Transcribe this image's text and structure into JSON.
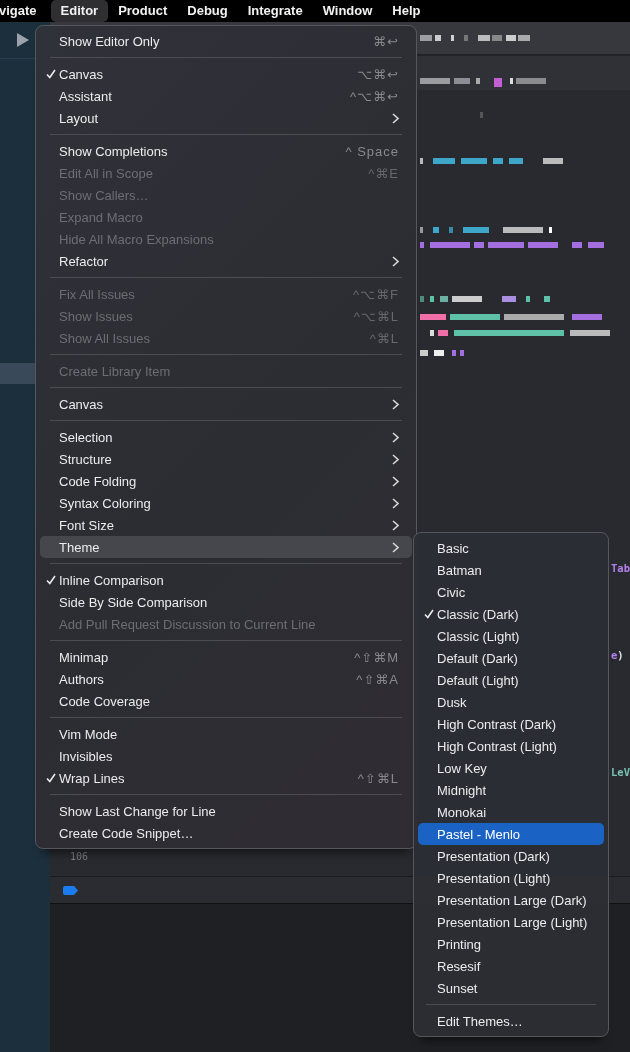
{
  "menubar": [
    {
      "label": "vigate",
      "selected": false
    },
    {
      "label": "Editor",
      "selected": true
    },
    {
      "label": "Product",
      "selected": false
    },
    {
      "label": "Debug",
      "selected": false
    },
    {
      "label": "Integrate",
      "selected": false
    },
    {
      "label": "Window",
      "selected": false
    },
    {
      "label": "Help",
      "selected": false
    }
  ],
  "editor_menu": {
    "items": [
      {
        "kind": "item",
        "label": "Show Editor Only",
        "shortcut": "⌘↩",
        "checked": false,
        "disabled": false,
        "submenu": false,
        "selected": false
      },
      {
        "kind": "separator"
      },
      {
        "kind": "item",
        "label": "Canvas",
        "shortcut": "⌥⌘↩",
        "checked": true,
        "disabled": false,
        "submenu": false,
        "selected": false
      },
      {
        "kind": "item",
        "label": "Assistant",
        "shortcut": "^⌥⌘↩",
        "checked": false,
        "disabled": false,
        "submenu": false,
        "selected": false
      },
      {
        "kind": "item",
        "label": "Layout",
        "checked": false,
        "disabled": false,
        "submenu": true,
        "selected": false
      },
      {
        "kind": "separator"
      },
      {
        "kind": "item",
        "label": "Show Completions",
        "shortcut": "^ Space",
        "checked": false,
        "disabled": false,
        "submenu": false,
        "selected": false
      },
      {
        "kind": "item",
        "label": "Edit All in Scope",
        "shortcut": "^⌘E",
        "checked": false,
        "disabled": true,
        "submenu": false,
        "selected": false
      },
      {
        "kind": "item",
        "label": "Show Callers…",
        "checked": false,
        "disabled": true,
        "submenu": false,
        "selected": false
      },
      {
        "kind": "item",
        "label": "Expand Macro",
        "checked": false,
        "disabled": true,
        "submenu": false,
        "selected": false
      },
      {
        "kind": "item",
        "label": "Hide All Macro Expansions",
        "checked": false,
        "disabled": true,
        "submenu": false,
        "selected": false
      },
      {
        "kind": "item",
        "label": "Refactor",
        "checked": false,
        "disabled": false,
        "submenu": true,
        "selected": false
      },
      {
        "kind": "separator"
      },
      {
        "kind": "item",
        "label": "Fix All Issues",
        "shortcut": "^⌥⌘F",
        "checked": false,
        "disabled": true,
        "submenu": false,
        "selected": false
      },
      {
        "kind": "item",
        "label": "Show Issues",
        "shortcut": "^⌥⌘L",
        "checked": false,
        "disabled": true,
        "submenu": false,
        "selected": false
      },
      {
        "kind": "item",
        "label": "Show All Issues",
        "shortcut": "^⌘L",
        "checked": false,
        "disabled": true,
        "submenu": false,
        "selected": false
      },
      {
        "kind": "separator"
      },
      {
        "kind": "item",
        "label": "Create Library Item",
        "checked": false,
        "disabled": true,
        "submenu": false,
        "selected": false
      },
      {
        "kind": "separator"
      },
      {
        "kind": "item",
        "label": "Canvas",
        "checked": false,
        "disabled": false,
        "submenu": true,
        "selected": false
      },
      {
        "kind": "separator"
      },
      {
        "kind": "item",
        "label": "Selection",
        "checked": false,
        "disabled": false,
        "submenu": true,
        "selected": false
      },
      {
        "kind": "item",
        "label": "Structure",
        "checked": false,
        "disabled": false,
        "submenu": true,
        "selected": false
      },
      {
        "kind": "item",
        "label": "Code Folding",
        "checked": false,
        "disabled": false,
        "submenu": true,
        "selected": false
      },
      {
        "kind": "item",
        "label": "Syntax Coloring",
        "checked": false,
        "disabled": false,
        "submenu": true,
        "selected": false
      },
      {
        "kind": "item",
        "label": "Font Size",
        "checked": false,
        "disabled": false,
        "submenu": true,
        "selected": false
      },
      {
        "kind": "item",
        "label": "Theme",
        "checked": false,
        "disabled": false,
        "submenu": true,
        "selected": true
      },
      {
        "kind": "separator"
      },
      {
        "kind": "item",
        "label": "Inline Comparison",
        "checked": true,
        "disabled": false,
        "submenu": false,
        "selected": false
      },
      {
        "kind": "item",
        "label": "Side By Side Comparison",
        "checked": false,
        "disabled": false,
        "submenu": false,
        "selected": false
      },
      {
        "kind": "item",
        "label": "Add Pull Request Discussion to Current Line",
        "checked": false,
        "disabled": true,
        "submenu": false,
        "selected": false
      },
      {
        "kind": "separator"
      },
      {
        "kind": "item",
        "label": "Minimap",
        "shortcut": "^⇧⌘M",
        "checked": false,
        "disabled": false,
        "submenu": false,
        "selected": false
      },
      {
        "kind": "item",
        "label": "Authors",
        "shortcut": "^⇧⌘A",
        "checked": false,
        "disabled": false,
        "submenu": false,
        "selected": false
      },
      {
        "kind": "item",
        "label": "Code Coverage",
        "checked": false,
        "disabled": false,
        "submenu": false,
        "selected": false
      },
      {
        "kind": "separator"
      },
      {
        "kind": "item",
        "label": "Vim Mode",
        "checked": false,
        "disabled": false,
        "submenu": false,
        "selected": false
      },
      {
        "kind": "item",
        "label": "Invisibles",
        "checked": false,
        "disabled": false,
        "submenu": false,
        "selected": false
      },
      {
        "kind": "item",
        "label": "Wrap Lines",
        "shortcut": "^⇧⌘L",
        "checked": true,
        "disabled": false,
        "submenu": false,
        "selected": false
      },
      {
        "kind": "separator"
      },
      {
        "kind": "item",
        "label": "Show Last Change for Line",
        "checked": false,
        "disabled": false,
        "submenu": false,
        "selected": false
      },
      {
        "kind": "item",
        "label": "Create Code Snippet…",
        "checked": false,
        "disabled": false,
        "submenu": false,
        "selected": false
      }
    ]
  },
  "theme_submenu": {
    "items": [
      {
        "kind": "item",
        "label": "Basic",
        "checked": false,
        "selected": false
      },
      {
        "kind": "item",
        "label": "Batman",
        "checked": false,
        "selected": false
      },
      {
        "kind": "item",
        "label": "Civic",
        "checked": false,
        "selected": false
      },
      {
        "kind": "item",
        "label": "Classic (Dark)",
        "checked": true,
        "selected": false
      },
      {
        "kind": "item",
        "label": "Classic (Light)",
        "checked": false,
        "selected": false
      },
      {
        "kind": "item",
        "label": "Default (Dark)",
        "checked": false,
        "selected": false
      },
      {
        "kind": "item",
        "label": "Default (Light)",
        "checked": false,
        "selected": false
      },
      {
        "kind": "item",
        "label": "Dusk",
        "checked": false,
        "selected": false
      },
      {
        "kind": "item",
        "label": "High Contrast (Dark)",
        "checked": false,
        "selected": false
      },
      {
        "kind": "item",
        "label": "High Contrast (Light)",
        "checked": false,
        "selected": false
      },
      {
        "kind": "item",
        "label": "Low Key",
        "checked": false,
        "selected": false
      },
      {
        "kind": "item",
        "label": "Midnight",
        "checked": false,
        "selected": false
      },
      {
        "kind": "item",
        "label": "Monokai",
        "checked": false,
        "selected": false
      },
      {
        "kind": "item",
        "label": "Pastel - Menlo",
        "checked": false,
        "selected": true
      },
      {
        "kind": "item",
        "label": "Presentation (Dark)",
        "checked": false,
        "selected": false
      },
      {
        "kind": "item",
        "label": "Presentation (Light)",
        "checked": false,
        "selected": false
      },
      {
        "kind": "item",
        "label": "Presentation Large (Dark)",
        "checked": false,
        "selected": false
      },
      {
        "kind": "item",
        "label": "Presentation Large (Light)",
        "checked": false,
        "selected": false
      },
      {
        "kind": "item",
        "label": "Printing",
        "checked": false,
        "selected": false
      },
      {
        "kind": "item",
        "label": "Resesif",
        "checked": false,
        "selected": false
      },
      {
        "kind": "item",
        "label": "Sunset",
        "checked": false,
        "selected": false
      },
      {
        "kind": "separator"
      },
      {
        "kind": "item",
        "label": "Edit Themes…",
        "checked": false,
        "selected": false
      }
    ]
  },
  "code_lines": [
    {
      "segments": [
        {
          "text": "Tab",
          "color": "#b281eb"
        }
      ]
    },
    {
      "segments": [
        {
          "text": "e",
          "color": "#b281eb"
        },
        {
          "text": ")",
          "color": "#e0e0e2"
        }
      ]
    },
    {
      "segments": [
        {
          "text": "LeV",
          "color": "#78c2b3"
        }
      ]
    }
  ],
  "line_number": "106"
}
